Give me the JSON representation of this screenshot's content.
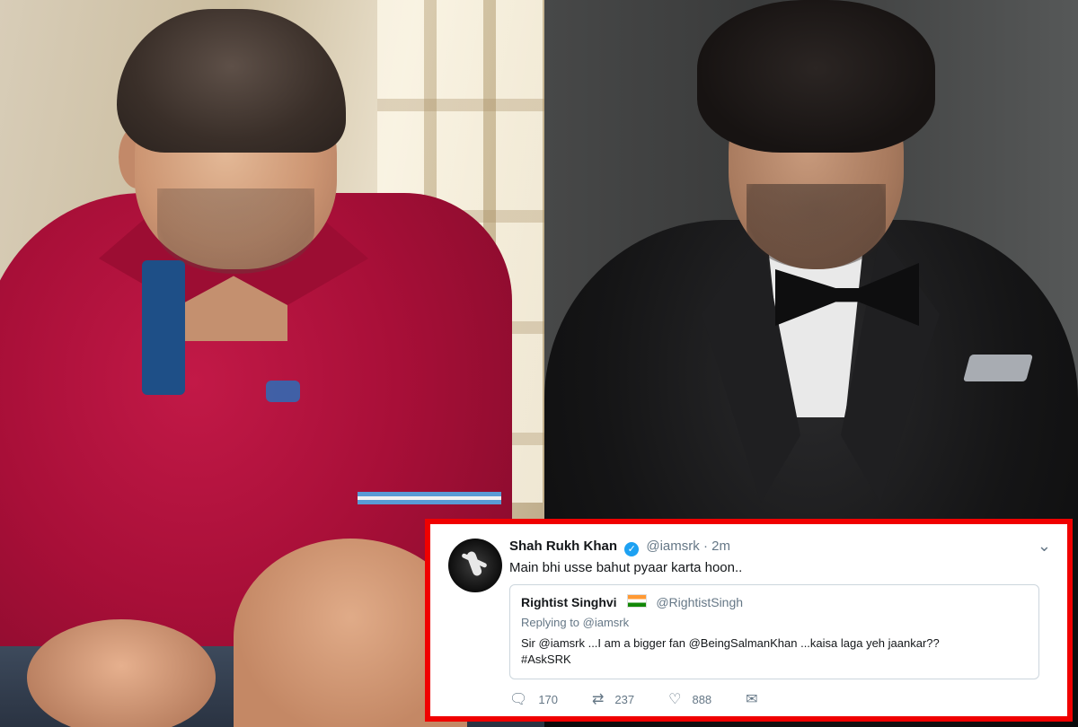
{
  "tweet": {
    "author_name": "Shah Rukh Khan",
    "handle": "@iamsrk",
    "separator": "·",
    "time": "2m",
    "text": "Main bhi usse bahut pyaar karta hoon..",
    "icons": {
      "verified": "verified-badge-icon",
      "menu": "chevron-down-icon"
    },
    "quoted": {
      "author_name": "Rightist Singhvi",
      "handle": "@RightistSingh",
      "flag": "india-flag-icon",
      "replying_to": "Replying to @iamsrk",
      "text_line1": "Sir @iamsrk ...I am a bigger fan @BeingSalmanKhan ...kaisa laga yeh jaankar??",
      "text_line2": "#AskSRK"
    },
    "actions": {
      "replies": "170",
      "retweets": "237",
      "likes": "888",
      "icons": [
        "reply-icon",
        "retweet-icon",
        "like-icon",
        "message-icon"
      ]
    }
  },
  "colors": {
    "frame_border": "#f00000",
    "verified": "#1da1f2",
    "muted_text": "#657786"
  }
}
